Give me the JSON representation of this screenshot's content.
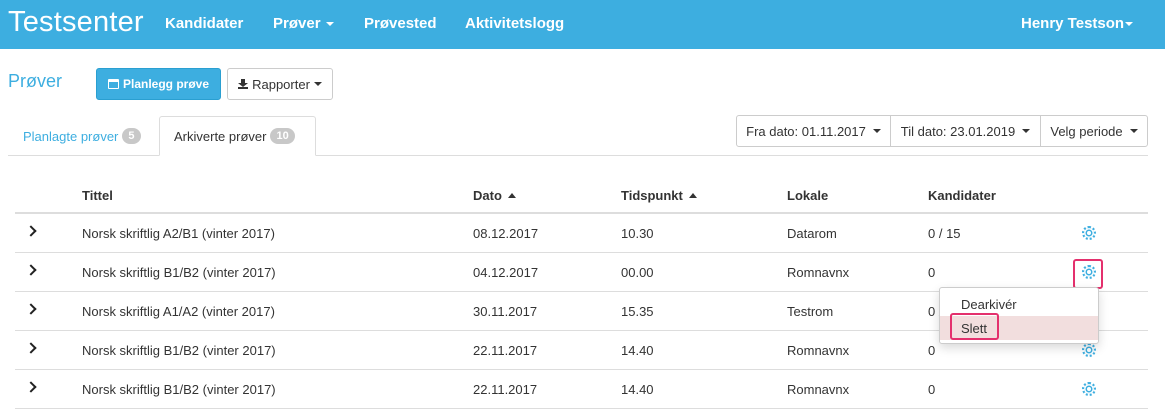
{
  "navbar": {
    "brand": "Testsenter",
    "items": [
      "Kandidater",
      "Prøver",
      "Prøvested",
      "Aktivitetslogg"
    ],
    "user": "Henry Testson"
  },
  "header": {
    "title": "Prøver",
    "plan_button": "Planlegg prøve",
    "reports_button": "Rapporter"
  },
  "tabs": [
    {
      "label": "Planlagte prøver",
      "count": "5"
    },
    {
      "label": "Arkiverte prøver",
      "count": "10"
    }
  ],
  "filters": {
    "from": "Fra dato: 01.11.2017",
    "to": "Til dato: 23.01.2019",
    "period": "Velg periode"
  },
  "table": {
    "columns": [
      "Tittel",
      "Dato",
      "Tidspunkt",
      "Lokale",
      "Kandidater"
    ],
    "rows": [
      {
        "title": "Norsk skriftlig A2/B1 (vinter 2017)",
        "date": "08.12.2017",
        "time": "10.30",
        "room": "Datarom",
        "candidates": "0 / 15"
      },
      {
        "title": "Norsk skriftlig B1/B2 (vinter 2017)",
        "date": "04.12.2017",
        "time": "00.00",
        "room": "Romnavnx",
        "candidates": "0"
      },
      {
        "title": "Norsk skriftlig A1/A2 (vinter 2017)",
        "date": "30.11.2017",
        "time": "15.35",
        "room": "Testrom",
        "candidates": "0 /"
      },
      {
        "title": "Norsk skriftlig B1/B2 (vinter 2017)",
        "date": "22.11.2017",
        "time": "14.40",
        "room": "Romnavnx",
        "candidates": "0"
      },
      {
        "title": "Norsk skriftlig B1/B2 (vinter 2017)",
        "date": "22.11.2017",
        "time": "14.40",
        "room": "Romnavnx",
        "candidates": "0"
      }
    ]
  },
  "dropdown": {
    "items": [
      "Dearkivér",
      "Slett"
    ]
  },
  "colors": {
    "primary": "#3daee0",
    "highlight": "#e4306d",
    "danger_bg": "#f2dede"
  }
}
